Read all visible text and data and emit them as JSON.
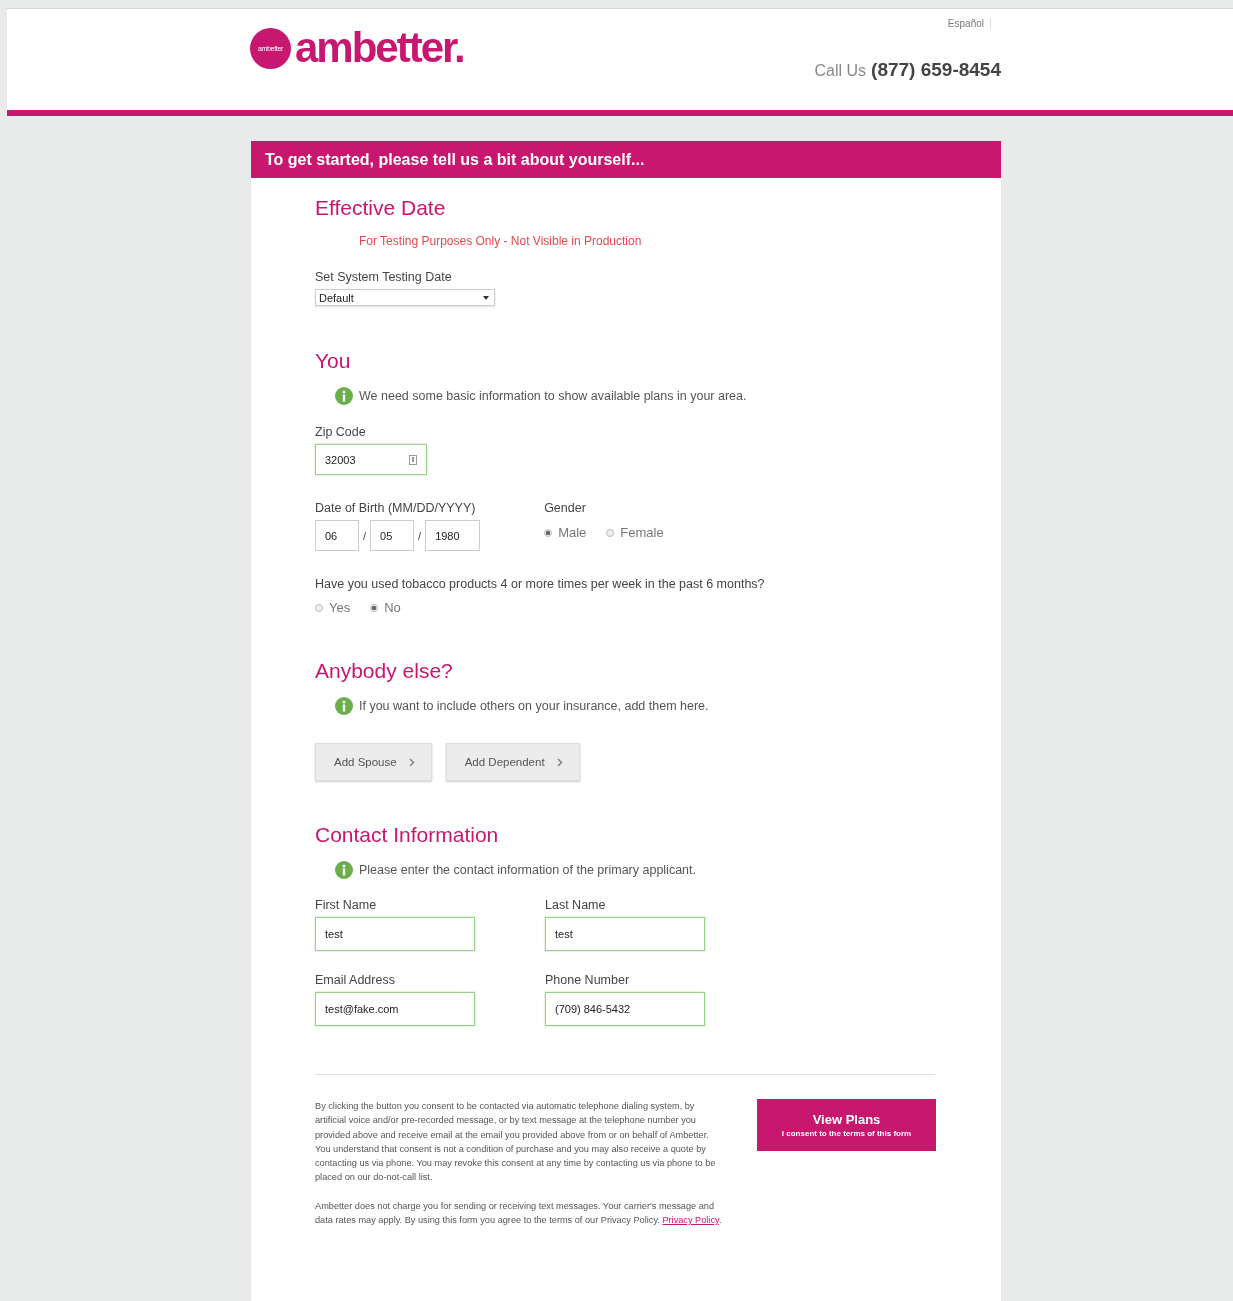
{
  "header": {
    "logo": {
      "badge_text": "ambetter",
      "wordmark": "ambetter."
    },
    "language_link": "Español",
    "call_label": "Call Us",
    "phone": "(877) 659-8454"
  },
  "banner": "To get started, please tell us a bit about yourself...",
  "effective_date": {
    "heading": "Effective Date",
    "notice": "For Testing Purposes Only - Not Visible in Production",
    "select_label": "Set System Testing Date",
    "select_value": "Default"
  },
  "you": {
    "heading": "You",
    "info": "We need some basic information to show available plans in your area.",
    "zip_label": "Zip Code",
    "zip_value": "32003",
    "dob_label": "Date of Birth (MM/DD/YYYY)",
    "dob": [
      {
        "value": "06"
      },
      {
        "value": "05"
      },
      {
        "value": "1980"
      }
    ],
    "dob_separators": [
      "/",
      "/"
    ],
    "gender_label": "Gender",
    "gender_options": [
      {
        "label": "Male",
        "selected": true
      },
      {
        "label": "Female",
        "selected": false
      }
    ],
    "tobacco_question": "Have you used tobacco products 4 or more times per week in the past 6 months?",
    "tobacco_options": [
      {
        "label": "Yes",
        "selected": false
      },
      {
        "label": "No",
        "selected": true
      }
    ]
  },
  "anybody_else": {
    "heading": "Anybody else?",
    "info": "If you want to include others on your insurance, add them here.",
    "buttons": [
      "Add Spouse",
      "Add Dependent"
    ]
  },
  "contact": {
    "heading": "Contact Information",
    "info": "Please enter the contact information of the primary applicant.",
    "fields": [
      {
        "label": "First Name",
        "value": "test"
      },
      {
        "label": "Last Name",
        "value": "test"
      },
      {
        "label": "Email Address",
        "value": "test@fake.com"
      },
      {
        "label": "Phone Number",
        "value": "(709) 846-5432"
      }
    ]
  },
  "consent": {
    "paragraph": "By clicking the button you consent to be contacted via automatic telephone dialing system, by artificial voice and/or pre-recorded message, or by text message at the telephone number you provided above and receive email at the email you provided above from or on behalf of Ambetter. You understand that consent is not a condition of purchase and you may also receive a quote by contacting us via phone. You may revoke this consent at any time by contacting us via phone to be placed on our do-not-call list.",
    "privacy_text": "Ambetter does not charge you for sending or receiving text messages. Your carrier's message and data rates may apply. By using this form you agree to the terms of our Privacy Policy.",
    "privacy_link": "Privacy Policy",
    "privacy_end": ".",
    "button_title": "View Plans",
    "button_subtitle": "I consent to the terms of this form"
  }
}
